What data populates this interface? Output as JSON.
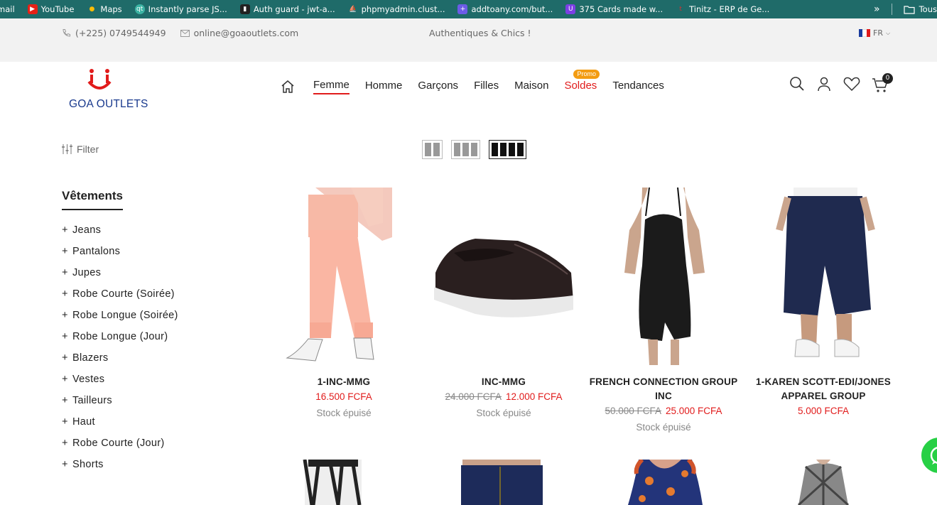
{
  "bookmarks": [
    {
      "label": "mail",
      "color": "#1f6b69",
      "icon": "mail-icon"
    },
    {
      "label": "YouTube",
      "color": "#e62117",
      "icon": "youtube-icon"
    },
    {
      "label": "Maps",
      "color": "#34a853",
      "icon": "maps-icon"
    },
    {
      "label": "Instantly parse JS...",
      "color": "#3bb3a3",
      "icon": "qt-icon"
    },
    {
      "label": "Auth guard - jwt-a...",
      "color": "#222222",
      "icon": "book-icon"
    },
    {
      "label": "phpmyadmin.clust...",
      "color": "#f29111",
      "icon": "pma-icon"
    },
    {
      "label": "addtoany.com/but...",
      "color": "#6c5ce7",
      "icon": "plus-icon"
    },
    {
      "label": "375 Cards made w...",
      "color": "#7b3fe4",
      "icon": "u-icon"
    },
    {
      "label": "Tinitz - ERP de Ge...",
      "color": "#d63031",
      "icon": "tinitz-icon"
    }
  ],
  "bookmarks_more": "»",
  "bookmarks_folder": "Tous",
  "topbar": {
    "phone": "(+225) 0749544949",
    "email": "online@goaoutlets.com",
    "tagline": "Authentiques & Chics !",
    "lang": "FR"
  },
  "header": {
    "brand": "GOA OUTLETS",
    "nav": [
      "Femme",
      "Homme",
      "Garçons",
      "Filles",
      "Maison",
      "Soldes",
      "Tendances"
    ],
    "promo_badge": "Promo",
    "cart_count": "0"
  },
  "toolbar": {
    "filter_label": "Filter"
  },
  "sidebar": {
    "title": "Vêtements",
    "categories": [
      "Jeans",
      "Pantalons",
      "Jupes",
      "Robe Courte (Soirée)",
      "Robe Longue (Soirée)",
      "Robe Longue (Jour)",
      "Blazers",
      "Vestes",
      "Tailleurs",
      "Haut",
      "Robe Courte (Jour)",
      "Shorts"
    ]
  },
  "products": [
    {
      "title": "1-INC-MMG",
      "old_price": "",
      "price": "16.500 FCFA",
      "stock": "Stock épuisé"
    },
    {
      "title": "INC-MMG",
      "old_price": "24.000 FCFA",
      "price": "12.000 FCFA",
      "stock": "Stock épuisé"
    },
    {
      "title": "FRENCH CONNECTION GROUP INC",
      "old_price": "50.000 FCFA",
      "price": "25.000 FCFA",
      "stock": "Stock épuisé"
    },
    {
      "title": "1-KAREN SCOTT-EDI/JONES APPAREL GROUP",
      "old_price": "",
      "price": "5.000 FCFA",
      "stock": ""
    }
  ],
  "colors": {
    "accent": "#e11b1b",
    "bookmark_bar": "#1f6b69",
    "promo": "#f39c12",
    "whatsapp": "#27d045",
    "brand": "#1a3a8e"
  }
}
